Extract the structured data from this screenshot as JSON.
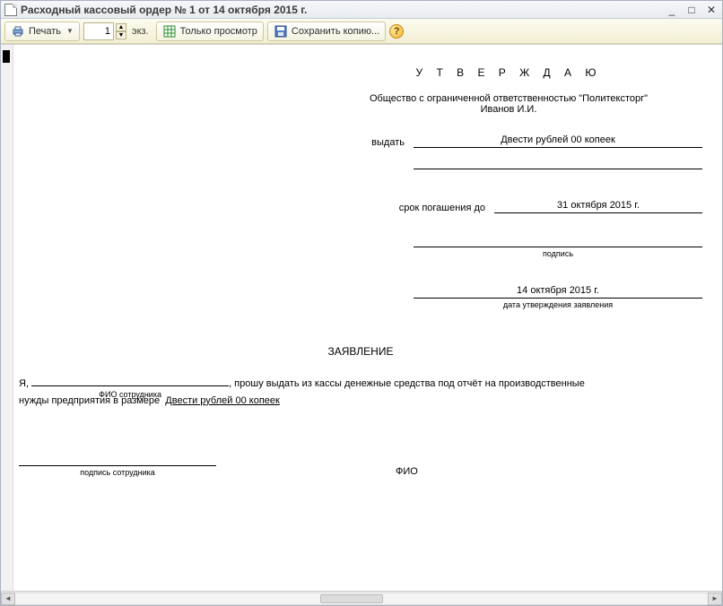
{
  "window": {
    "title": "Расходный кассовый ордер № 1 от 14 октября 2015 г."
  },
  "toolbar": {
    "print_label": "Печать",
    "copies_value": "1",
    "copies_unit": "экз.",
    "preview_only_label": "Только просмотр",
    "save_copy_label": "Сохранить копию..."
  },
  "doc": {
    "approve_title": "У Т В Е Р Ж Д А Ю",
    "org_line1": "Общество с ограниченной ответственностью \"Политексторг\"",
    "org_line2": "Иванов И.И.",
    "issue_label": "выдать",
    "issue_amount": "Двести рублей 00 копеек",
    "due_label": "срок погашения до",
    "due_date": "31 октября 2015 г.",
    "signature_hint": "подпись",
    "approval_date": "14 октября 2015 г.",
    "approval_date_hint": "дата утверждения заявления",
    "statement_title": "ЗАЯВЛЕНИЕ",
    "body_prefix": "Я,",
    "body_fio_hint": "ФИО сотрудника",
    "body_middle": ", прошу выдать из кассы денежные средства под отчёт на производственные",
    "body_line2_prefix": "нужды предприятия в размере",
    "body_amount": "Двести рублей 00 копеек",
    "emp_signature_hint": "подпись сотрудника",
    "fio_label": "ФИО"
  }
}
